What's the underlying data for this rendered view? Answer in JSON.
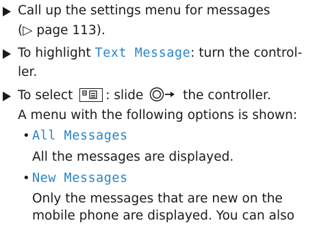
{
  "step1": {
    "line1": "Call up the settings menu for messages",
    "line2": "(▷ page 113)."
  },
  "step2": {
    "prefix": "To highlight ",
    "highlight": "Text Message",
    "suffix": ": turn the control-",
    "line2": "ler."
  },
  "step3": {
    "prefix": "To select ",
    "middle": ": slide ",
    "suffix": " the controller.",
    "line2": "A menu with the following options is shown:",
    "icons": [
      "message-key-icon",
      "controller-slide-right-icon"
    ]
  },
  "options": [
    {
      "label": "All Messages",
      "description": [
        "All the messages are displayed."
      ]
    },
    {
      "label": "New Messages",
      "description": [
        "Only the messages that are new on the",
        "mobile phone are displayed. You can also"
      ]
    }
  ],
  "colors": {
    "highlight": "#2a84c6",
    "text": "#1a1a1a"
  }
}
